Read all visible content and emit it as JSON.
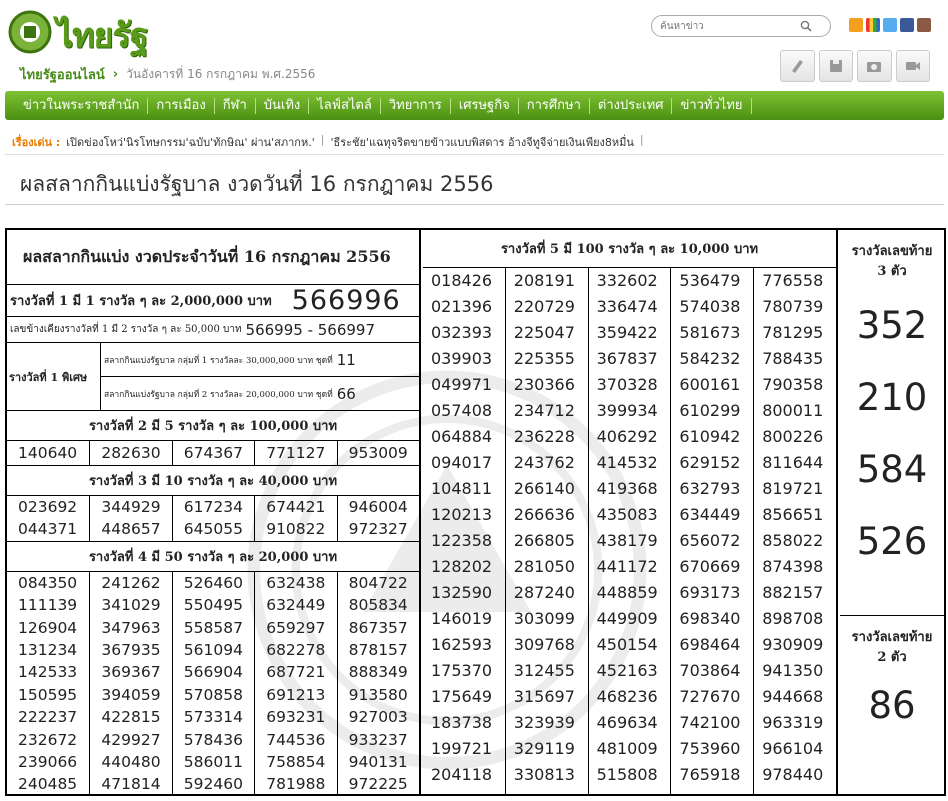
{
  "site": {
    "logo_text": "ไทยรัฐ",
    "breadcrumb_site": "ไทยรัฐออนไลน์",
    "breadcrumb_arrow": "›",
    "date": "วันอังคารที่ 16 กรกฎาคม พ.ศ.2556"
  },
  "search": {
    "placeholder": "ค้นหาข่าว"
  },
  "nav": [
    "ข่าวในพระราชสำนัก",
    "การเมือง",
    "กีฬา",
    "บันเทิง",
    "ไลฟ์สไตล์",
    "วิทยาการ",
    "เศรษฐกิจ",
    "การศึกษา",
    "ต่างประเทศ",
    "ข่าวทั่วไทย"
  ],
  "headlines": {
    "label": "เรื่องเด่น :",
    "items": [
      "เปิดข่องโหว่'นิรโทษกรรม'ฉบับ'ทักษิณ' ผ่าน'สภากห.'",
      "'ธีระชัย'แฉทุจริตขายข้าวแบบพิสดาร อ้างจีทูจีจ่ายเงินเพียง8หมื่น"
    ],
    "separator": "|"
  },
  "page_title": "ผลสลากกินแบ่งรัฐบาล งวดวันที่ 16 กรกฎาคม 2556",
  "board": {
    "heading": "ผลสลากกินแบ่ง งวดประจำวันที่ 16 กรกฎาคม 2556",
    "prize1": {
      "label": "รางวัลที่ 1 มี 1 รางวัล ๆ ละ 2,000,000 บาท",
      "number": "566996"
    },
    "adjacent": {
      "label": "เลขข้างเคียงรางวัลที่ 1 มี 2 รางวัล ๆ ละ 50,000 บาท",
      "value": "566995 - 566997"
    },
    "special": {
      "label": "รางวัลที่ 1 พิเศษ",
      "rows": [
        {
          "text": "สลากกินแบ่งรัฐบาล กลุ่มที่ 1 รางวัลละ 30,000,000 บาท ชุดที่",
          "num": "11"
        },
        {
          "text": "สลากกินแบ่งรัฐบาล กลุ่มที่ 2 รางวัลละ 20,000,000 บาท ชุดที่",
          "num": "66"
        }
      ]
    },
    "prize2": {
      "label": "รางวัลที่ 2 มี 5 รางวัล ๆ ละ 100,000 บาท",
      "numbers": [
        "140640",
        "282630",
        "674367",
        "771127",
        "953009"
      ]
    },
    "prize3": {
      "label": "รางวัลที่ 3 มี 10 รางวัล ๆ ละ 40,000 บาท",
      "rows": [
        [
          "023692",
          "344929",
          "617234",
          "674421",
          "946004"
        ],
        [
          "044371",
          "448657",
          "645055",
          "910822",
          "972327"
        ]
      ]
    },
    "prize4": {
      "label": "รางวัลที่ 4 มี 50 รางวัล ๆ ละ 20,000 บาท",
      "cols": [
        [
          "084350",
          "111139",
          "126904",
          "131234",
          "142533",
          "150595",
          "222237",
          "232672",
          "239066",
          "240485"
        ],
        [
          "241262",
          "341029",
          "347963",
          "367935",
          "369367",
          "394059",
          "422815",
          "429927",
          "440480",
          "471814"
        ],
        [
          "526460",
          "550495",
          "558587",
          "561094",
          "566904",
          "570858",
          "573314",
          "578436",
          "586011",
          "592460"
        ],
        [
          "632438",
          "632449",
          "659297",
          "682278",
          "687721",
          "691213",
          "693231",
          "744536",
          "758854",
          "781988"
        ],
        [
          "804722",
          "805834",
          "867357",
          "878157",
          "888349",
          "913580",
          "927003",
          "933237",
          "940131",
          "972225"
        ]
      ]
    },
    "prize5": {
      "label": "รางวัลที่ 5 มี 100 รางวัล ๆ ละ 10,000 บาท",
      "cols": [
        [
          "018426",
          "021396",
          "032393",
          "039903",
          "049971",
          "057408",
          "064884",
          "094017",
          "104811",
          "120213",
          "122358",
          "128202",
          "132590",
          "146019",
          "162593",
          "175370",
          "175649",
          "183738",
          "199721",
          "204118"
        ],
        [
          "208191",
          "220729",
          "225047",
          "225355",
          "230366",
          "234712",
          "236228",
          "243762",
          "266140",
          "266636",
          "266805",
          "281050",
          "287240",
          "303099",
          "309768",
          "312455",
          "315697",
          "323939",
          "329119",
          "330813"
        ],
        [
          "332602",
          "336474",
          "359422",
          "367837",
          "370328",
          "399934",
          "406292",
          "414532",
          "419368",
          "435083",
          "438179",
          "441172",
          "448859",
          "449909",
          "450154",
          "452163",
          "468236",
          "469634",
          "481009",
          "515808"
        ],
        [
          "536479",
          "574038",
          "581673",
          "584232",
          "600161",
          "610299",
          "610942",
          "629152",
          "632793",
          "634449",
          "656072",
          "670669",
          "693173",
          "698340",
          "698464",
          "703864",
          "727670",
          "742100",
          "753960",
          "765918"
        ],
        [
          "776558",
          "780739",
          "781295",
          "788435",
          "790358",
          "800011",
          "800226",
          "811644",
          "819721",
          "856651",
          "858022",
          "874398",
          "882157",
          "898708",
          "930909",
          "941350",
          "944668",
          "963319",
          "966104",
          "978440"
        ]
      ]
    },
    "last3": {
      "label_line1": "รางวัลเลขท้าย",
      "label_line2": "3 ตัว",
      "numbers": [
        "352",
        "210",
        "584",
        "526"
      ]
    },
    "last2": {
      "label_line1": "รางวัลเลขท้าย",
      "label_line2": "2 ตัว",
      "number": "86"
    }
  },
  "colors": {
    "nav_green": "#5fa21f",
    "site_green": "#4a8c1c",
    "headline_label": "#e87c00"
  }
}
